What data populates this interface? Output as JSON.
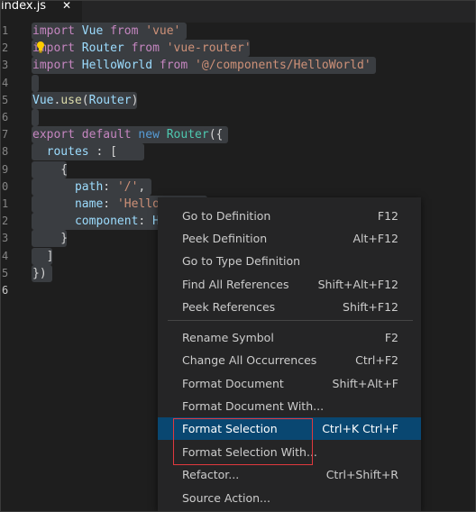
{
  "tab": {
    "filename": "index.js",
    "close_glyph": "✕"
  },
  "editor": {
    "line_numbers": [
      "1",
      "2",
      "3",
      "4",
      "5",
      "6",
      "7",
      "8",
      "9",
      "0",
      "1",
      "2",
      "3",
      "4",
      "5",
      "6"
    ],
    "lines": [
      [
        [
          "kw",
          "import"
        ],
        [
          "punc",
          " "
        ],
        [
          "var",
          "Vue"
        ],
        [
          "punc",
          " "
        ],
        [
          "kw",
          "from"
        ],
        [
          "punc",
          " "
        ],
        [
          "str",
          "'vue'"
        ]
      ],
      [
        [
          "kw",
          "import"
        ],
        [
          "punc",
          " "
        ],
        [
          "var",
          "Router"
        ],
        [
          "punc",
          " "
        ],
        [
          "kw",
          "from"
        ],
        [
          "punc",
          " "
        ],
        [
          "str",
          "'vue-router'"
        ]
      ],
      [
        [
          "kw",
          "import"
        ],
        [
          "punc",
          " "
        ],
        [
          "var",
          "HelloWorld"
        ],
        [
          "punc",
          " "
        ],
        [
          "kw",
          "from"
        ],
        [
          "punc",
          " "
        ],
        [
          "str",
          "'@/components/HelloWorld'"
        ]
      ],
      [],
      [
        [
          "var",
          "Vue"
        ],
        [
          "punc",
          "."
        ],
        [
          "fn",
          "use"
        ],
        [
          "punc",
          "("
        ],
        [
          "var",
          "Router"
        ],
        [
          "punc",
          ")"
        ]
      ],
      [],
      [
        [
          "kw",
          "export"
        ],
        [
          "punc",
          " "
        ],
        [
          "kw",
          "default"
        ],
        [
          "punc",
          " "
        ],
        [
          "kw2",
          "new"
        ],
        [
          "punc",
          " "
        ],
        [
          "cls",
          "Router"
        ],
        [
          "punc",
          "({"
        ]
      ],
      [
        [
          "punc",
          "  "
        ],
        [
          "var",
          "routes"
        ],
        [
          "punc",
          " : ["
        ]
      ],
      [
        [
          "punc",
          "    {"
        ]
      ],
      [
        [
          "punc",
          "      "
        ],
        [
          "var",
          "path"
        ],
        [
          "punc",
          ": "
        ],
        [
          "str",
          "'/'"
        ],
        [
          "punc",
          ","
        ]
      ],
      [
        [
          "punc",
          "      "
        ],
        [
          "var",
          "name"
        ],
        [
          "punc",
          ": "
        ],
        [
          "str",
          "'Hello"
        ]
      ],
      [
        [
          "punc",
          "      "
        ],
        [
          "var",
          "component"
        ],
        [
          "punc",
          ": "
        ],
        [
          "var",
          "H"
        ]
      ],
      [
        [
          "punc",
          "    }"
        ]
      ],
      [
        [
          "punc",
          "  ]"
        ]
      ],
      [
        [
          "punc",
          "})"
        ]
      ],
      []
    ]
  },
  "context_menu": {
    "items": [
      {
        "label": "Go to Definition",
        "shortcut": "F12"
      },
      {
        "label": "Peek Definition",
        "shortcut": "Alt+F12"
      },
      {
        "label": "Go to Type Definition",
        "shortcut": ""
      },
      {
        "label": "Find All References",
        "shortcut": "Shift+Alt+F12"
      },
      {
        "label": "Peek References",
        "shortcut": "Shift+F12"
      },
      {
        "label": "Rename Symbol",
        "shortcut": "F2"
      },
      {
        "label": "Change All Occurrences",
        "shortcut": "Ctrl+F2"
      },
      {
        "label": "Format Document",
        "shortcut": "Shift+Alt+F"
      },
      {
        "label": "Format Document With...",
        "shortcut": ""
      },
      {
        "label": "Format Selection",
        "shortcut": "Ctrl+K Ctrl+F"
      },
      {
        "label": "Format Selection With...",
        "shortcut": ""
      },
      {
        "label": "Refactor...",
        "shortcut": "Ctrl+Shift+R"
      },
      {
        "label": "Source Action...",
        "shortcut": ""
      }
    ],
    "active_label": "Format Selection"
  },
  "colors": {
    "editor_bg": "#1e1e1e",
    "menu_bg": "#252526",
    "menu_highlight": "#094771",
    "selection_bg": "#3a3d41",
    "annotation_box": "#e0393e"
  },
  "icons": {
    "lightbulb": "lightbulb-icon"
  }
}
